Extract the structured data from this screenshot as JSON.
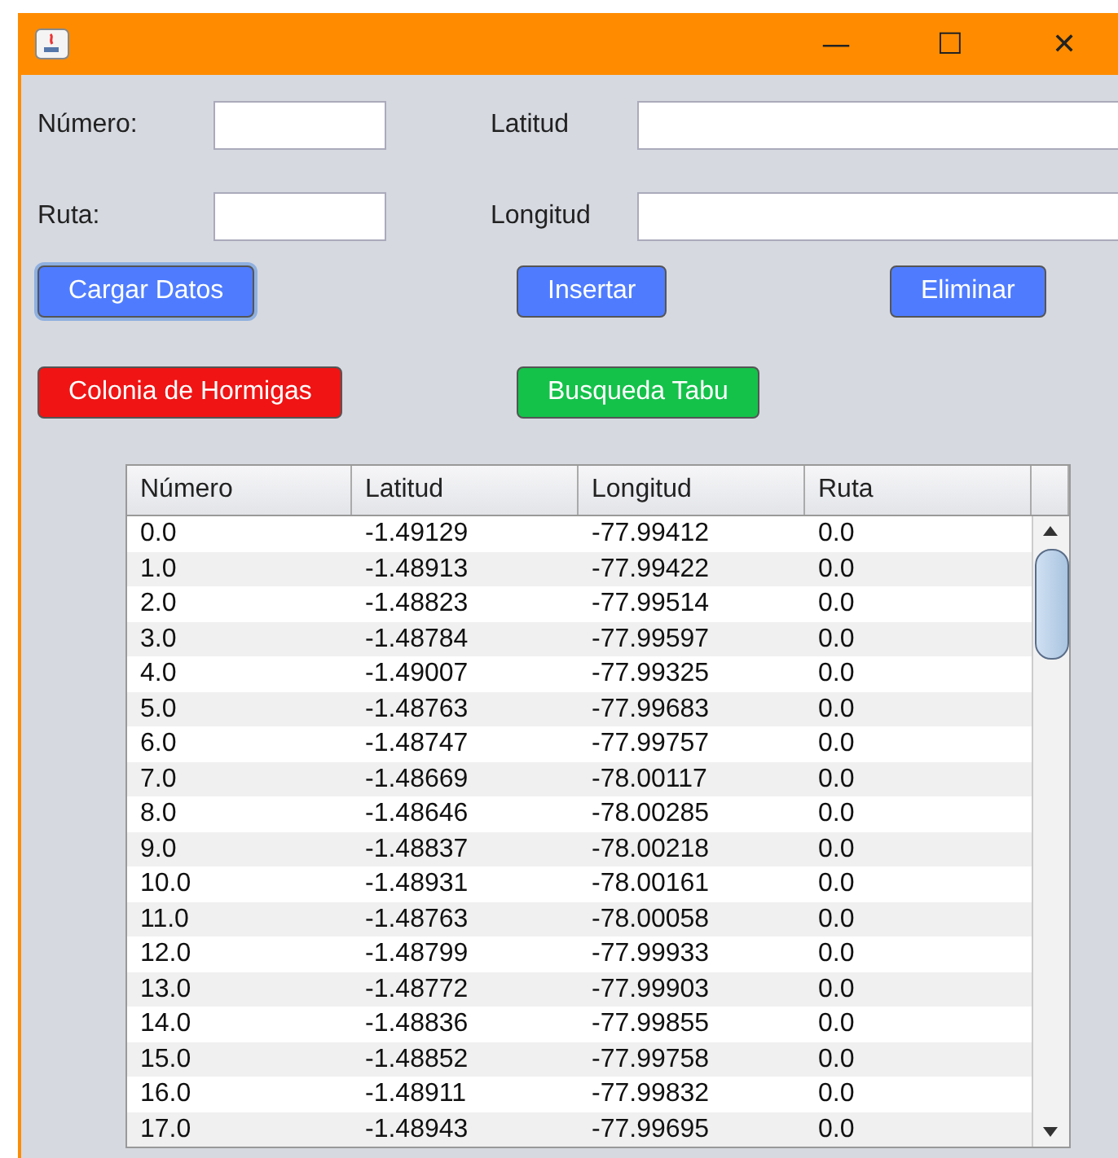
{
  "window": {
    "title_buttons": [
      "—",
      "☐",
      "✕"
    ]
  },
  "form": {
    "fields": [
      {
        "label": "Número:"
      },
      {
        "label": "Latitud"
      },
      {
        "label": "Ruta:"
      },
      {
        "label": "Longitud"
      }
    ]
  },
  "buttons": [
    {
      "label": "Cargar Datos",
      "color": "#4f7cff",
      "focused": true
    },
    {
      "label": "Insertar",
      "color": "#4f7cff",
      "focused": false
    },
    {
      "label": "Eliminar",
      "color": "#4f7cff",
      "focused": false
    },
    {
      "label": "Colonia de Hormigas",
      "color": "#f01414",
      "focused": false
    },
    {
      "label": "Busqueda Tabu",
      "color": "#14c24a",
      "focused": false
    }
  ],
  "table": {
    "columns": [
      "Número",
      "Latitud",
      "Longitud",
      "Ruta"
    ],
    "rows": [
      [
        "0.0",
        "-1.49129",
        "-77.99412",
        "0.0"
      ],
      [
        "1.0",
        "-1.48913",
        "-77.99422",
        "0.0"
      ],
      [
        "2.0",
        "-1.48823",
        "-77.99514",
        "0.0"
      ],
      [
        "3.0",
        "-1.48784",
        "-77.99597",
        "0.0"
      ],
      [
        "4.0",
        "-1.49007",
        "-77.99325",
        "0.0"
      ],
      [
        "5.0",
        "-1.48763",
        "-77.99683",
        "0.0"
      ],
      [
        "6.0",
        "-1.48747",
        "-77.99757",
        "0.0"
      ],
      [
        "7.0",
        "-1.48669",
        "-78.00117",
        "0.0"
      ],
      [
        "8.0",
        "-1.48646",
        "-78.00285",
        "0.0"
      ],
      [
        "9.0",
        "-1.48837",
        "-78.00218",
        "0.0"
      ],
      [
        "10.0",
        "-1.48931",
        "-78.00161",
        "0.0"
      ],
      [
        "11.0",
        "-1.48763",
        "-78.00058",
        "0.0"
      ],
      [
        "12.0",
        "-1.48799",
        "-77.99933",
        "0.0"
      ],
      [
        "13.0",
        "-1.48772",
        "-77.99903",
        "0.0"
      ],
      [
        "14.0",
        "-1.48836",
        "-77.99855",
        "0.0"
      ],
      [
        "15.0",
        "-1.48852",
        "-77.99758",
        "0.0"
      ],
      [
        "16.0",
        "-1.48911",
        "-77.99832",
        "0.0"
      ],
      [
        "17.0",
        "-1.48943",
        "-77.99695",
        "0.0"
      ]
    ]
  }
}
